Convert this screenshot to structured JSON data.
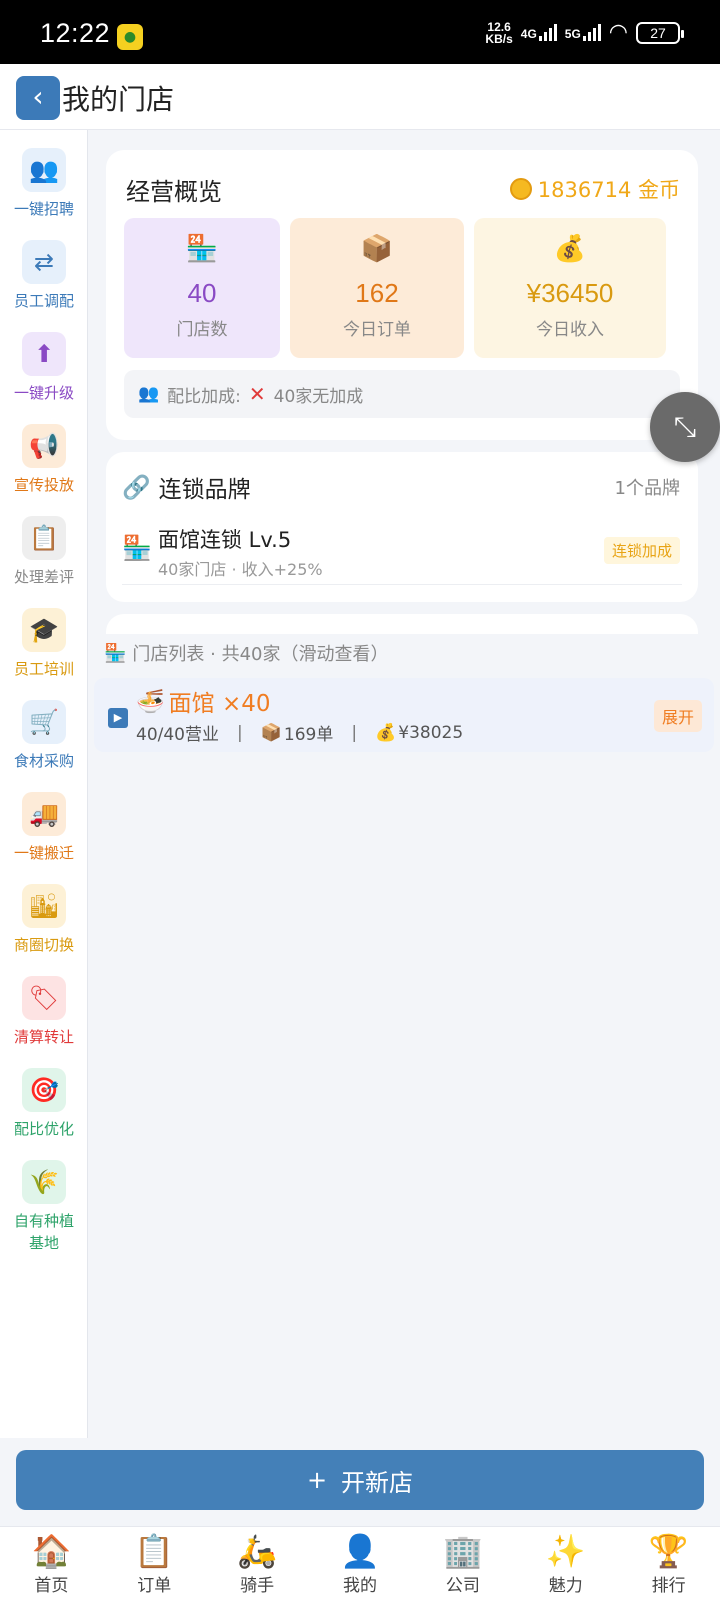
{
  "status_bar": {
    "time": "12:22",
    "net_speed_value": "12.6",
    "net_speed_unit": "KB/s",
    "sig1": "4G",
    "sig2": "5G",
    "battery": "27"
  },
  "header": {
    "back_glyph": "‹",
    "title": "我的门店"
  },
  "sidebar": {
    "items": [
      {
        "icon": "recruit-icon",
        "glyph": "👥",
        "label": "一键招聘",
        "color": "#3c7ab8",
        "bg": "#e6f0fb"
      },
      {
        "icon": "shuffle-icon",
        "glyph": "⇄",
        "label": "员工调配",
        "color": "#3c7ab8",
        "bg": "#e6f0fb"
      },
      {
        "icon": "upgrade-icon",
        "glyph": "⬆",
        "label": "一键升级",
        "color": "#8a4ac4",
        "bg": "#efe6fb"
      },
      {
        "icon": "megaphone-icon",
        "glyph": "📢",
        "label": "宣传投放",
        "color": "#e07818",
        "bg": "#fdebd8"
      },
      {
        "icon": "clipboard-icon",
        "glyph": "📋",
        "label": "处理差评",
        "color": "#888888",
        "bg": "#eeeeee"
      },
      {
        "icon": "graduation-cap-icon",
        "glyph": "🎓",
        "label": "员工培训",
        "color": "#d99a10",
        "bg": "#fdf1d6"
      },
      {
        "icon": "cart-icon",
        "glyph": "🛒",
        "label": "食材采购",
        "color": "#3c7ab8",
        "bg": "#e6f0fb"
      },
      {
        "icon": "truck-icon",
        "glyph": "🚚",
        "label": "一键搬迁",
        "color": "#e07818",
        "bg": "#fdebd8"
      },
      {
        "icon": "city-icon",
        "glyph": "🏙",
        "label": "商圈切换",
        "color": "#d99a10",
        "bg": "#fdf1d6"
      },
      {
        "icon": "tag-icon",
        "glyph": "🏷",
        "label": "清算转让",
        "color": "#e03a3a",
        "bg": "#fde3e3"
      },
      {
        "icon": "target-icon",
        "glyph": "🎯",
        "label": "配比优化",
        "color": "#2ea36a",
        "bg": "#e0f5ea"
      },
      {
        "icon": "plant-icon",
        "glyph": "🌾",
        "label": "自有种植基地",
        "color": "#2ea36a",
        "bg": "#e0f5ea"
      }
    ]
  },
  "overview": {
    "title": "经营概览",
    "coins": "1836714 金币",
    "stats": [
      {
        "icon": "store-icon",
        "glyph": "🏪",
        "value": "40",
        "label": "门店数",
        "color": "#8a4ac4",
        "bg": "#efe6fb"
      },
      {
        "icon": "package-icon",
        "glyph": "📦",
        "value": "162",
        "label": "今日订单",
        "color": "#e07818",
        "bg": "#fdebd8"
      },
      {
        "icon": "money-bag-icon",
        "glyph": "💰",
        "value": "¥36450",
        "label": "今日收入",
        "color": "#d99a10",
        "bg": "#fdf5e2"
      }
    ],
    "ratio_label": "配比加成:",
    "ratio_mark": "✕",
    "ratio_value": "40家无加成"
  },
  "brand": {
    "title": "连锁品牌",
    "count": "1个品牌",
    "name": "面馆连锁 Lv.5",
    "sub": "40家门店 · 收入+25%",
    "badge": "连锁加成"
  },
  "store_list": {
    "header": "门店列表 · 共40家（滑动查看）",
    "row": {
      "name": "面馆 ×40",
      "open": "40/40营业",
      "orders": "169单",
      "income": "¥38025",
      "expand": "展开"
    }
  },
  "open_button": {
    "plus": "+",
    "label": "开新店"
  },
  "tabs": [
    {
      "icon": "home-icon",
      "glyph": "🏠",
      "label": "首页"
    },
    {
      "icon": "order-icon",
      "glyph": "📋",
      "label": "订单"
    },
    {
      "icon": "scooter-icon",
      "glyph": "🛵",
      "label": "骑手"
    },
    {
      "icon": "profile-icon",
      "glyph": "👤",
      "label": "我的"
    },
    {
      "icon": "company-icon",
      "glyph": "🏢",
      "label": "公司"
    },
    {
      "icon": "sparkle-icon",
      "glyph": "✨",
      "label": "魅力"
    },
    {
      "icon": "trophy-icon",
      "glyph": "🏆",
      "label": "排行"
    }
  ]
}
